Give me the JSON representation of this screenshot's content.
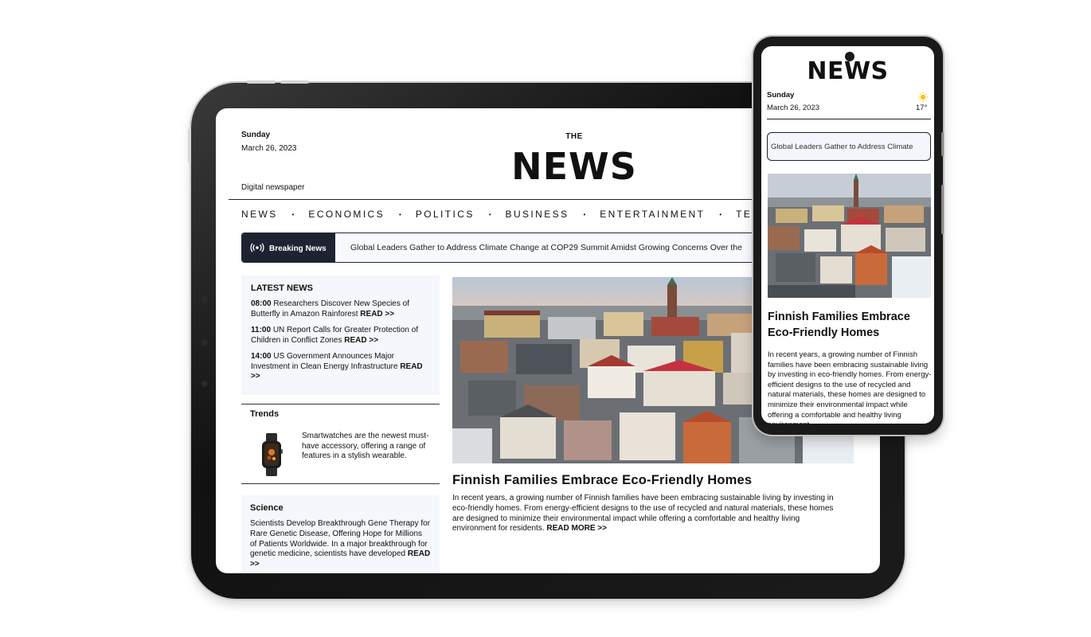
{
  "tablet": {
    "day": "Sunday",
    "date": "March 26, 2023",
    "tagline": "Digital newspaper",
    "masthead_the": "THE",
    "masthead": "NEWS",
    "nav": [
      "NEWS",
      "ECONOMICS",
      "POLITICS",
      "BUSINESS",
      "ENTERTAINMENT",
      "TECHNO"
    ],
    "nav_separator": "•",
    "breaking": {
      "label": "Breaking News",
      "ticker": "Global Leaders Gather to Address Climate Change at COP29 Summit Amidst Growing Concerns Over the"
    },
    "latest": {
      "title": "LATEST NEWS",
      "items": [
        {
          "time": "08:00",
          "text": "Researchers Discover New Species of Butterfly in Amazon Rainforest",
          "more": "READ >>"
        },
        {
          "time": "11:00",
          "text": "UN Report Calls for Greater Protection of Children in Conflict Zones",
          "more": "READ >>"
        },
        {
          "time": "14:00",
          "text": "US Government Announces Major Investment in Clean Energy Infrastructure",
          "more": "READ >>"
        }
      ]
    },
    "trends": {
      "title": "Trends",
      "text": "Smartwatches are the newest must-have accessory, offering a range of features in a stylish wearable."
    },
    "science": {
      "title": "Science",
      "text": "Scientists Develop Breakthrough Gene Therapy for Rare Genetic Disease, Offering Hope for Millions of Patients Worldwide. In a major breakthrough for genetic medicine, scientists have developed",
      "more": "READ >>"
    },
    "feature": {
      "title": "Finnish Families Embrace Eco-Friendly Homes",
      "body": "In recent years, a growing number of Finnish families have been embracing sustainable living by investing in eco-friendly homes. From energy-efficient designs to the use of recycled and natural materials, these homes are designed to minimize their environmental impact while offering a comfortable and healthy living environment for residents.",
      "more": "READ MORE >>"
    }
  },
  "phone": {
    "masthead": "NEWS",
    "day": "Sunday",
    "date": "March 26, 2023",
    "temperature": "17°",
    "weather_icon": "sun-icon",
    "ticker": "Global Leaders Gather to Address Climate",
    "feature_title": "Finnish Families Embrace Eco-Friendly Homes",
    "feature_body": "In recent years, a growing number of Finnish families have been embracing sustainable living by investing in eco-friendly homes. From energy-efficient designs to the use of recycled and natural materials, these homes are designed to minimize their environmental impact while offering a comfortable and healthy living environment"
  },
  "colors": {
    "dark_navy": "#1d2330",
    "panel_bg": "#f4f7fb",
    "sun": "#f5c518"
  }
}
